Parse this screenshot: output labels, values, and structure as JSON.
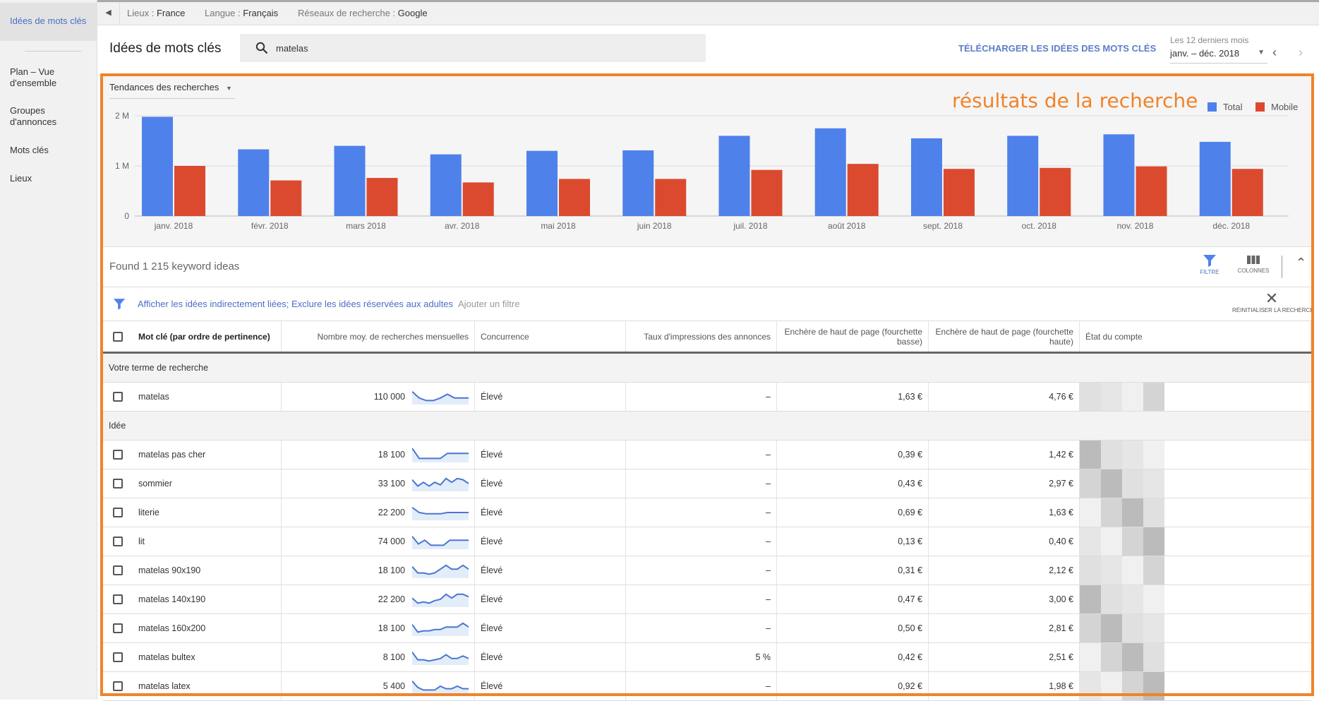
{
  "sidebar": {
    "items": [
      {
        "label": "Idées de mots clés",
        "active": true
      },
      {
        "label": "Plan – Vue d'ensemble"
      },
      {
        "label": "Groupes d'annonces"
      },
      {
        "label": "Mots clés"
      },
      {
        "label": "Lieux"
      }
    ]
  },
  "topbar": {
    "location_label": "Lieux :",
    "location": "France",
    "language_label": "Langue :",
    "language": "Français",
    "network_label": "Réseaux de recherche :",
    "network": "Google"
  },
  "header": {
    "title": "Idées de mots clés",
    "search_value": "matelas",
    "download": "TÉLÉCHARGER LES IDÉES DES MOTS CLÉS",
    "period_label": "Les 12 derniers mois",
    "period_value": "janv. – déc. 2018"
  },
  "annotation": "résultats de la recherche",
  "colors": {
    "total": "#4f81ea",
    "mobile": "#db4a2f",
    "accent": "#5b7fc9",
    "annotation": "#f0832a"
  },
  "chart_data": {
    "type": "bar",
    "dropdown": "Tendances des recherches",
    "categories": [
      "janv. 2018",
      "févr. 2018",
      "mars 2018",
      "avr. 2018",
      "mai 2018",
      "juin 2018",
      "juil. 2018",
      "août 2018",
      "sept. 2018",
      "oct. 2018",
      "nov. 2018",
      "déc. 2018"
    ],
    "series": [
      {
        "name": "Total",
        "values": [
          1980000,
          1330000,
          1400000,
          1230000,
          1300000,
          1310000,
          1600000,
          1750000,
          1550000,
          1600000,
          1630000,
          1480000
        ]
      },
      {
        "name": "Mobile",
        "values": [
          1000000,
          710000,
          760000,
          670000,
          740000,
          740000,
          920000,
          1040000,
          940000,
          960000,
          990000,
          940000
        ]
      }
    ],
    "yticks": [
      {
        "v": 0,
        "label": "0"
      },
      {
        "v": 1000000,
        "label": "1 M"
      },
      {
        "v": 2000000,
        "label": "2 M"
      }
    ],
    "ylim": [
      0,
      2000000
    ],
    "grid": true,
    "legend": "top-right"
  },
  "results": {
    "found": "Found 1 215 keyword ideas",
    "filter_label": "FILTRE",
    "columns_label": "COLONNES",
    "filters_text": "Afficher les idées indirectement liées; Exclure les idées réservées aux adultes",
    "add_filter": "Ajouter un filtre",
    "reset": "RÉINITIALISER LA RECHERCHE"
  },
  "table": {
    "columns": [
      "Mot clé (par ordre de pertinence)",
      "Nombre moy. de recherches mensuelles",
      "Concurrence",
      "Taux d'impressions des annonces",
      "Enchère de haut de page (fourchette basse)",
      "Enchère de haut de page (fourchette haute)",
      "État du compte"
    ],
    "section_search": "Votre terme de recherche",
    "section_ideas": "Idée",
    "search_row": {
      "keyword": "matelas",
      "volume": "110 000",
      "competition": "Élevé",
      "impr": "–",
      "low": "1,63 €",
      "high": "4,76 €",
      "trend": [
        9,
        4,
        2,
        2,
        4,
        7,
        4,
        4,
        4
      ]
    },
    "rows": [
      {
        "keyword": "matelas pas cher",
        "volume": "18 100",
        "competition": "Élevé",
        "impr": "–",
        "low": "0,39 €",
        "high": "1,42 €",
        "trend": [
          10,
          2,
          2,
          2,
          2,
          6,
          6,
          6,
          6
        ]
      },
      {
        "keyword": "sommier",
        "volume": "33 100",
        "competition": "Élevé",
        "impr": "–",
        "low": "0,43 €",
        "high": "2,97 €",
        "trend": [
          8,
          3,
          6,
          3,
          6,
          4,
          9,
          6,
          9,
          8,
          5
        ]
      },
      {
        "keyword": "literie",
        "volume": "22 200",
        "competition": "Élevé",
        "impr": "–",
        "low": "0,69 €",
        "high": "1,63 €",
        "trend": [
          9,
          5,
          4,
          4,
          4,
          5,
          5,
          5,
          5
        ]
      },
      {
        "keyword": "lit",
        "volume": "74 000",
        "competition": "Élevé",
        "impr": "–",
        "low": "0,13 €",
        "high": "0,40 €",
        "trend": [
          9,
          3,
          6,
          2,
          2,
          2,
          6,
          6,
          6,
          6
        ]
      },
      {
        "keyword": "matelas 90x190",
        "volume": "18 100",
        "competition": "Élevé",
        "impr": "–",
        "low": "0,31 €",
        "high": "2,12 €",
        "trend": [
          8,
          3,
          3,
          2,
          3,
          6,
          9,
          6,
          6,
          9,
          6
        ]
      },
      {
        "keyword": "matelas 140x190",
        "volume": "22 200",
        "competition": "Élevé",
        "impr": "–",
        "low": "0,47 €",
        "high": "3,00 €",
        "trend": [
          6,
          2,
          3,
          2,
          4,
          5,
          9,
          6,
          9,
          9,
          7
        ]
      },
      {
        "keyword": "matelas 160x200",
        "volume": "18 100",
        "competition": "Élevé",
        "impr": "–",
        "low": "0,50 €",
        "high": "2,81 €",
        "trend": [
          8,
          2,
          3,
          3,
          4,
          4,
          6,
          6,
          6,
          9,
          6
        ]
      },
      {
        "keyword": "matelas bultex",
        "volume": "8 100",
        "competition": "Élevé",
        "impr": "5 %",
        "low": "0,42 €",
        "high": "2,51 €",
        "trend": [
          9,
          3,
          3,
          2,
          3,
          4,
          7,
          4,
          4,
          6,
          4
        ]
      },
      {
        "keyword": "matelas latex",
        "volume": "5 400",
        "competition": "Élevé",
        "impr": "–",
        "low": "0,92 €",
        "high": "1,98 €",
        "trend": [
          9,
          4,
          2,
          2,
          2,
          5,
          3,
          3,
          5,
          3,
          3
        ]
      }
    ]
  }
}
